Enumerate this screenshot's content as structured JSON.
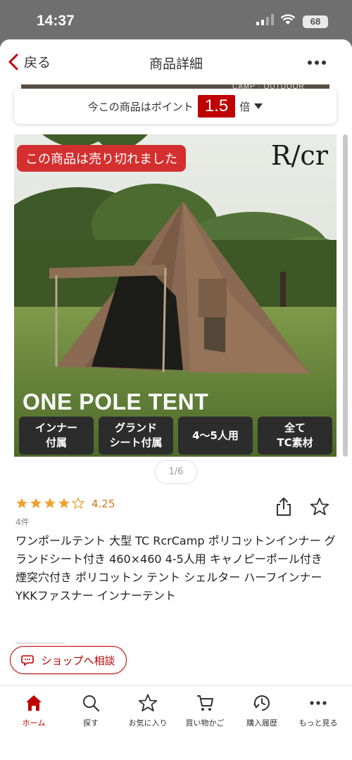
{
  "status_bar": {
    "time": "14:37",
    "battery": "68"
  },
  "header": {
    "back_label": "戻る",
    "title": "商品詳細"
  },
  "banner": {
    "partial_text": "CAMP · OUTDOOR"
  },
  "point_box": {
    "prefix": "今この商品はポイント",
    "value": "1.5",
    "suffix": "倍"
  },
  "product_image": {
    "sold_out_label": "この商品は売り切れました",
    "brand": "R/cr",
    "headline": "ONE POLE TENT",
    "features": [
      "インナー\n付属",
      "グランド\nシート付属",
      "4〜5人用",
      "全て\nTC素材"
    ]
  },
  "pager": "1/6",
  "rating": {
    "value": "4.25",
    "stars": 4.25,
    "count": "4件"
  },
  "product_name": "ワンポールテント 大型 TC RcrCamp ポリコットンインナー グランドシート付き 460×460 4-5人用 キャノピーポール付き 煙突穴付き ポリコットン テント シェルター ハーフインナー YKKファスナー インナーテント",
  "consult_button": "ショップへ相談",
  "tabs": [
    {
      "label": "ホーム",
      "icon": "home-icon",
      "active": true
    },
    {
      "label": "探す",
      "icon": "search-icon",
      "active": false
    },
    {
      "label": "お気に入り",
      "icon": "star-icon",
      "active": false
    },
    {
      "label": "買い物かご",
      "icon": "cart-icon",
      "active": false
    },
    {
      "label": "購入履歴",
      "icon": "history-icon",
      "active": false
    },
    {
      "label": "もっと見る",
      "icon": "more-icon",
      "active": false
    }
  ],
  "colors": {
    "accent": "#bf0000",
    "star": "#f0a030",
    "rating_text": "#c97a1c",
    "sold_out_bg": "#d42f2f"
  }
}
